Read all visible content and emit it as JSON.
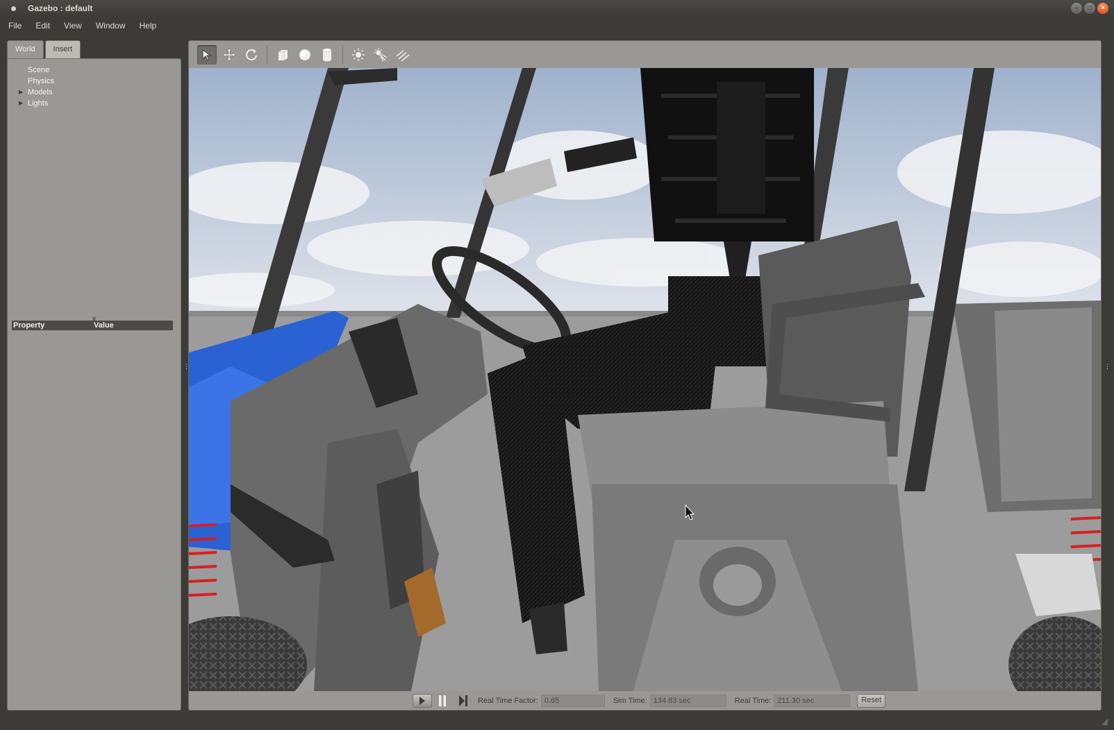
{
  "window": {
    "title": "Gazebo : default"
  },
  "menu": [
    "File",
    "Edit",
    "View",
    "Window",
    "Help"
  ],
  "left_panel": {
    "tabs": [
      {
        "label": "World",
        "active": true
      },
      {
        "label": "Insert",
        "active": false
      }
    ],
    "tree": [
      {
        "label": "Scene",
        "expandable": false
      },
      {
        "label": "Physics",
        "expandable": false
      },
      {
        "label": "Models",
        "expandable": true
      },
      {
        "label": "Lights",
        "expandable": true
      }
    ],
    "property_header": {
      "property": "Property",
      "value": "Value"
    }
  },
  "toolbar": {
    "tools": [
      "select-arrow-icon",
      "translate-icon",
      "rotate-icon",
      "box-icon",
      "sphere-icon",
      "cylinder-icon",
      "point-light-icon",
      "spot-light-icon",
      "directional-light-icon"
    ],
    "active_tool": "select-arrow-icon"
  },
  "bottom_bar": {
    "real_time_factor_label": "Real Time Factor:",
    "real_time_factor": "0.65",
    "sim_time_label": "Sim Time:",
    "sim_time": "134.83 sec",
    "real_time_label": "Real Time:",
    "real_time": "211.30 sec",
    "reset_label": "Reset"
  },
  "colors": {
    "chrome": "#3c3b37",
    "panel": "#9a9894",
    "header": "#4c4b47",
    "close_button": "#e05a1f",
    "sky": "#b8c4d4",
    "vehicle_blue": "#2a62d4"
  }
}
